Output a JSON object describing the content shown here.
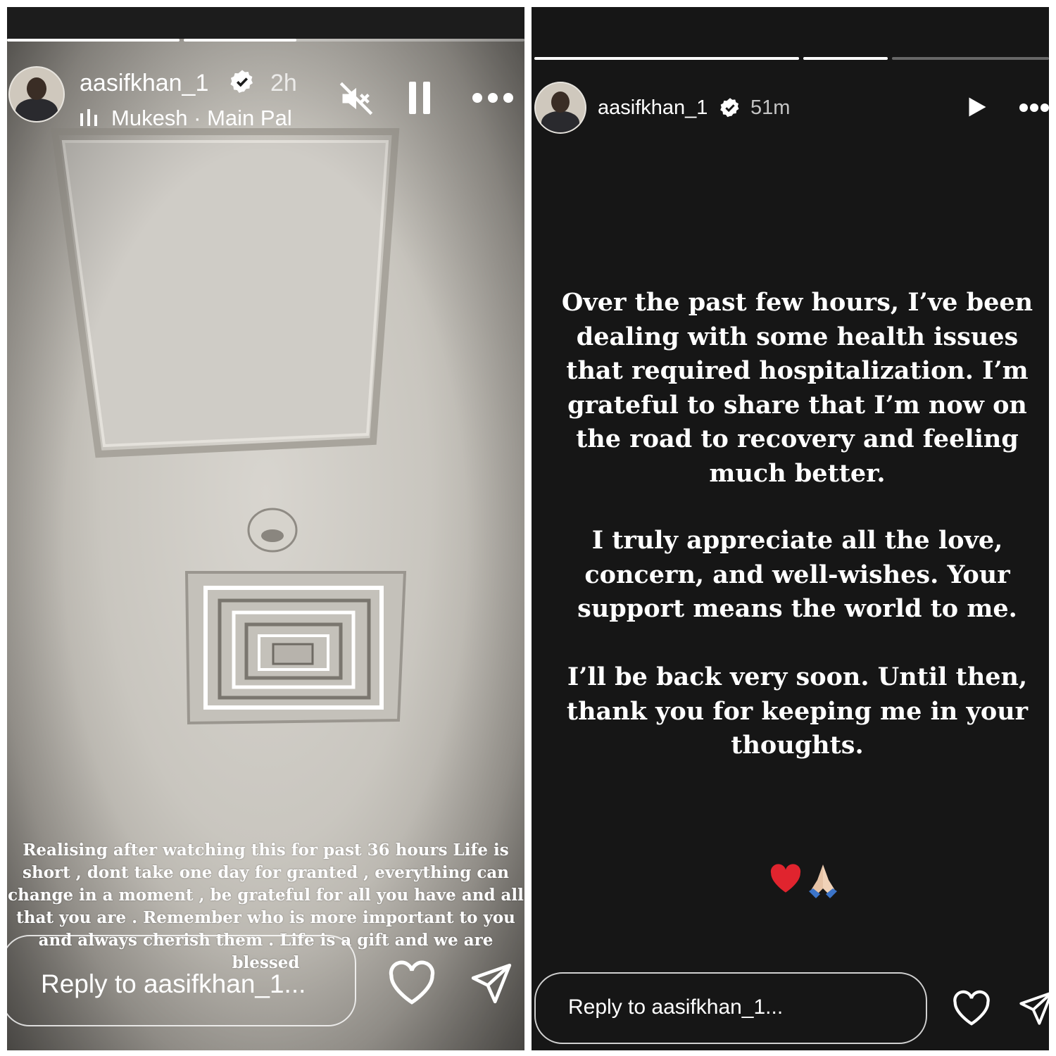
{
  "story1": {
    "username": "aasifkhan_1",
    "time_ago": "2h",
    "music_icon": "music-bars-icon",
    "music": "Mukesh · Main Pal",
    "caption": "Realising after watching this for past 36 hours Life is short , dont take one day for granted , everything can change in a moment , be grateful for all you have and all that you are . Remember who is more important to you and always cherish them . Life is a gift and we are blessed",
    "reply_placeholder": "Reply to aasifkhan_1...",
    "progress": [
      1.0,
      0.33
    ]
  },
  "story2": {
    "username": "aasifkhan_1",
    "time_ago": "51m",
    "paragraph1": "Over the past few hours, I’ve been dealing with some health issues that required hospitalization. I’m grateful to share that I’m now on the road to recovery and feeling much better.",
    "paragraph2": "I truly appreciate all the love, concern, and well-wishes. Your support means the world to me.",
    "paragraph3": "I’ll be back very soon. Until then, thank you for keeping me in your thoughts.",
    "emoji_heart": "❤️",
    "emoji_hands": "🙏🏼",
    "reply_placeholder": "Reply to aasifkhan_1...",
    "progress": [
      1.0,
      1.0,
      0.0
    ]
  },
  "colors": {
    "text": "#ffffff",
    "story2_bg": "#161616"
  }
}
